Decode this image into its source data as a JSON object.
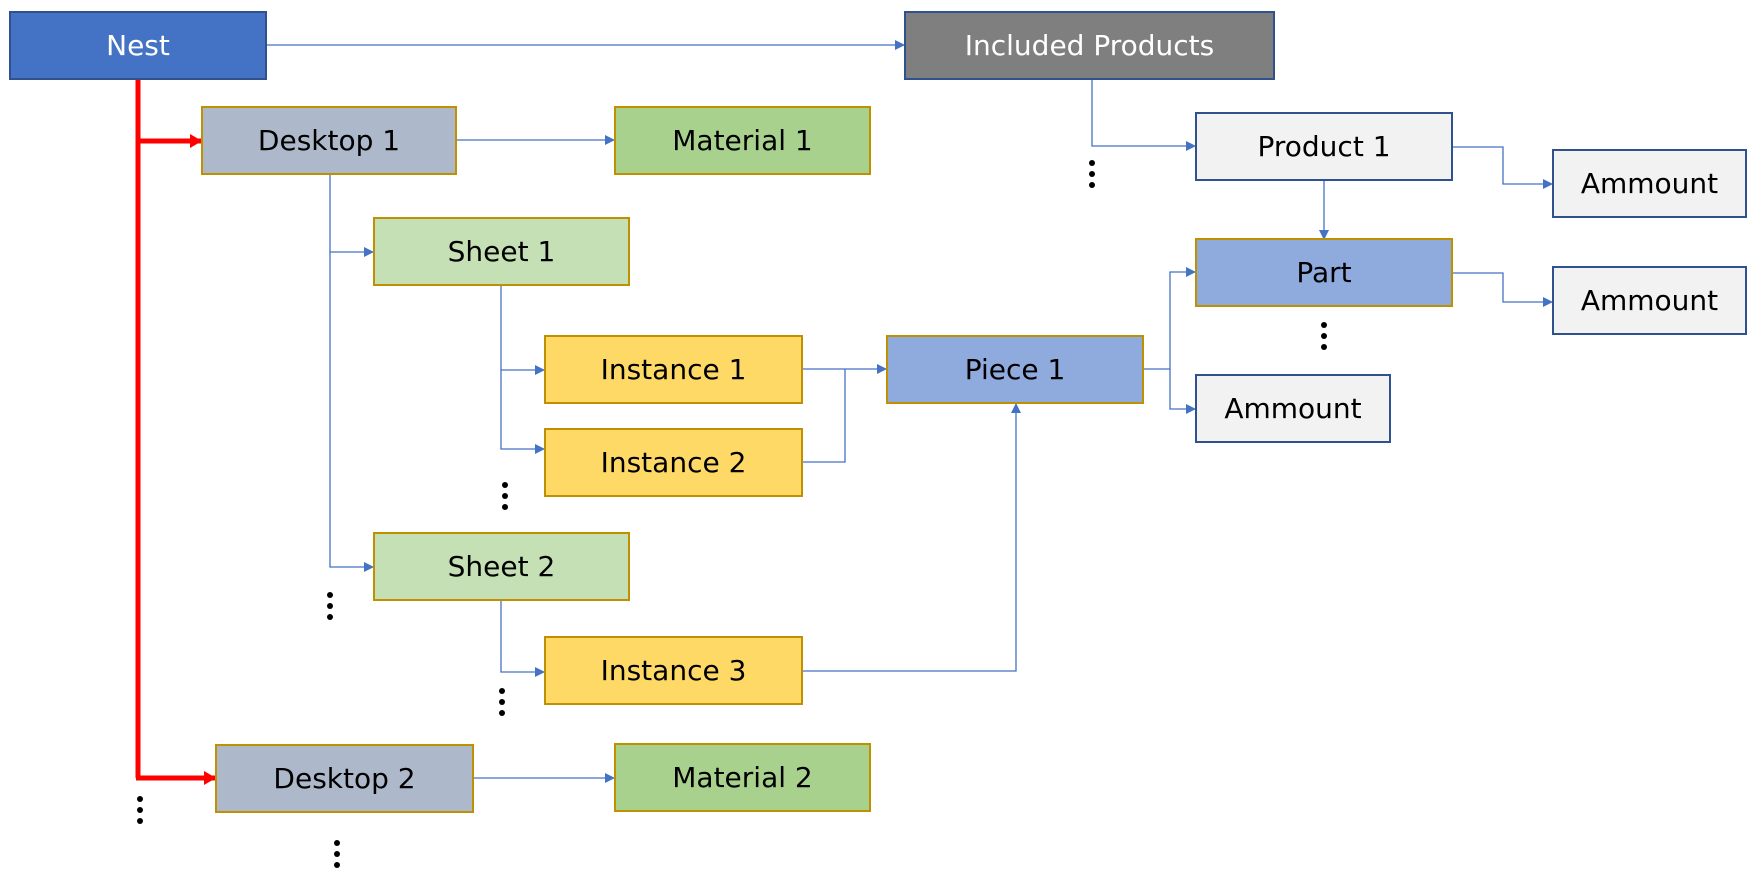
{
  "diagram": {
    "nodes": {
      "nest": "Nest",
      "included_products": "Included Products",
      "desktop_1": "Desktop 1",
      "material_1": "Material 1",
      "sheet_1": "Sheet 1",
      "instance_1": "Instance 1",
      "instance_2": "Instance 2",
      "sheet_2": "Sheet 2",
      "instance_3": "Instance 3",
      "desktop_2": "Desktop 2",
      "material_2": "Material 2",
      "piece_1": "Piece 1",
      "product_1": "Product 1",
      "part": "Part",
      "amount_product": "Ammount",
      "amount_part": "Ammount",
      "amount_piece": "Ammount"
    },
    "colors": {
      "connector": "#4472c4",
      "highlight_connector": "#ff0000"
    }
  }
}
